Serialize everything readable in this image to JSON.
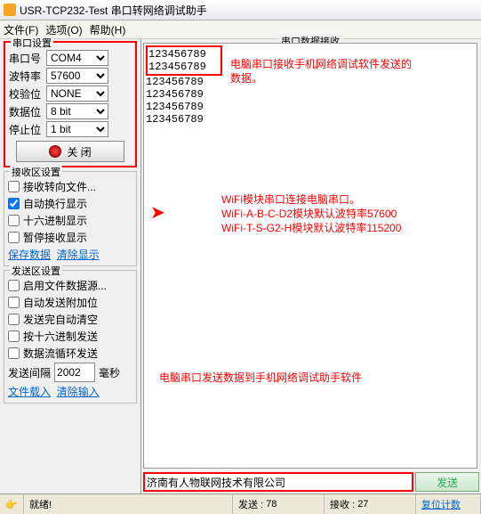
{
  "title": "USR-TCP232-Test 串口转网络调试助手",
  "menu": {
    "file": "文件(F)",
    "options": "选项(O)",
    "help": "帮助(H)"
  },
  "serial": {
    "title": "串口设置",
    "port": {
      "label": "串口号",
      "value": "COM4"
    },
    "baud": {
      "label": "波特率",
      "value": "57600"
    },
    "parity": {
      "label": "校验位",
      "value": "NONE"
    },
    "data": {
      "label": "数据位",
      "value": "8 bit"
    },
    "stop": {
      "label": "停止位",
      "value": "1 bit"
    },
    "close": "关 闭"
  },
  "rx": {
    "title": "接收区设置",
    "opts": [
      "接收转向文件...",
      "自动换行显示",
      "十六进制显示",
      "暂停接收显示"
    ],
    "checked": [
      false,
      true,
      false,
      false
    ],
    "save": "保存数据",
    "clear": "清除显示"
  },
  "tx": {
    "title": "发送区设置",
    "opts": [
      "启用文件数据源...",
      "自动发送附加位",
      "发送完自动清空",
      "按十六进制发送",
      "数据流循环发送"
    ],
    "interval_lbl": "发送间隔",
    "interval_val": "2002",
    "interval_unit": "毫秒",
    "load": "文件载入",
    "clear": "清除输入"
  },
  "rxdata": {
    "title": "串口数据接收",
    "lines": [
      "123456789",
      "123456789",
      "123456789",
      "123456789",
      "123456789",
      "123456789"
    ]
  },
  "notes": {
    "n1a": "电脑串口接收手机网络调试软件发送的",
    "n1b": "数据。",
    "n2a": "WiFi模块串口连接电脑串口。",
    "n2b": "WiFi-A-B-C-D2模块默认波特率57600",
    "n2c": "WiFi-T-S-G2-H模块默认波特率115200",
    "n3": "电脑串口发送数据到手机网络调试助手软件"
  },
  "sendtext": "济南有人物联网技术有限公司",
  "sendbtn": "发送",
  "status": {
    "ready": "就绪!",
    "sent_lbl": "发送 :",
    "sent": "78",
    "recv_lbl": "接收 :",
    "recv": "27",
    "reset": "复位计数"
  }
}
